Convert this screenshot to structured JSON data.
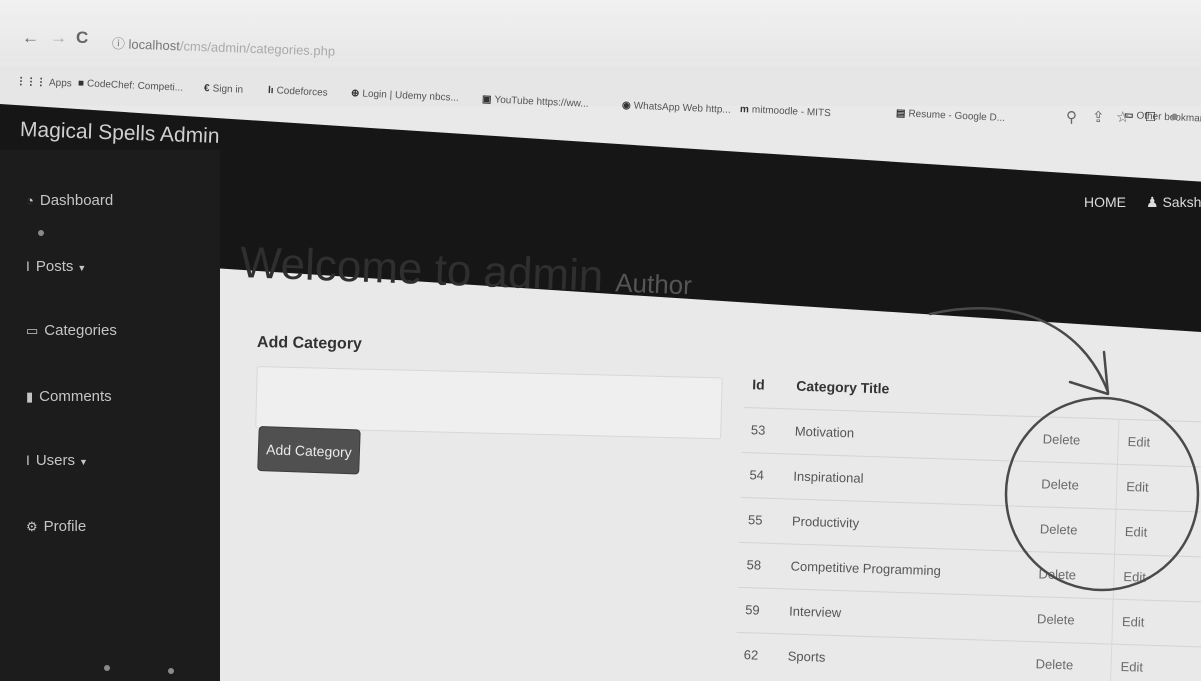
{
  "browser": {
    "back": "←",
    "forward": "→",
    "reload": "C",
    "url_host": "localhost",
    "url_path": "/cms/admin/categories.php",
    "bookmarks": [
      {
        "label": "Apps"
      },
      {
        "label": "CodeChef: Competi..."
      },
      {
        "label": "Sign in"
      },
      {
        "label": "Codeforces"
      },
      {
        "label": "Login | Udemy nbcs..."
      },
      {
        "label": "YouTube https://ww..."
      },
      {
        "label": "WhatsApp Web http..."
      },
      {
        "label": "mitmoodle - MITS"
      },
      {
        "label": "Resume - Google D..."
      },
      {
        "label": "Other bookmarks"
      }
    ]
  },
  "app": {
    "brand": "Magical Spells Admin",
    "top_nav": {
      "home": "HOME",
      "user": "Sakshi"
    }
  },
  "sidebar": {
    "items": [
      {
        "label": "Dashboard",
        "icon": "dashboard-icon"
      },
      {
        "label": "Posts",
        "icon": "posts-icon",
        "has_caret": true
      },
      {
        "label": "Categories",
        "icon": "desktop-icon"
      },
      {
        "label": "Comments",
        "icon": "file-icon"
      },
      {
        "label": "Users",
        "icon": "user-icon",
        "has_caret": true
      },
      {
        "label": "Profile",
        "icon": "gear-icon"
      }
    ]
  },
  "main": {
    "title": "Welcome to admin",
    "subtitle": "Author",
    "form": {
      "label": "Add Category",
      "input_value": "",
      "button_label": "Add Category"
    },
    "table": {
      "headers": {
        "id": "Id",
        "title": "Category Title"
      },
      "rows": [
        {
          "id": "53",
          "title": "Motivation",
          "delete": "Delete",
          "edit": "Edit"
        },
        {
          "id": "54",
          "title": "Inspirational",
          "delete": "Delete",
          "edit": "Edit"
        },
        {
          "id": "55",
          "title": "Productivity",
          "delete": "Delete",
          "edit": "Edit"
        },
        {
          "id": "58",
          "title": "Competitive Programming",
          "delete": "Delete",
          "edit": "Edit"
        },
        {
          "id": "59",
          "title": "Interview",
          "delete": "Delete",
          "edit": "Edit"
        },
        {
          "id": "62",
          "title": "Sports",
          "delete": "Delete",
          "edit": "Edit"
        }
      ]
    }
  }
}
